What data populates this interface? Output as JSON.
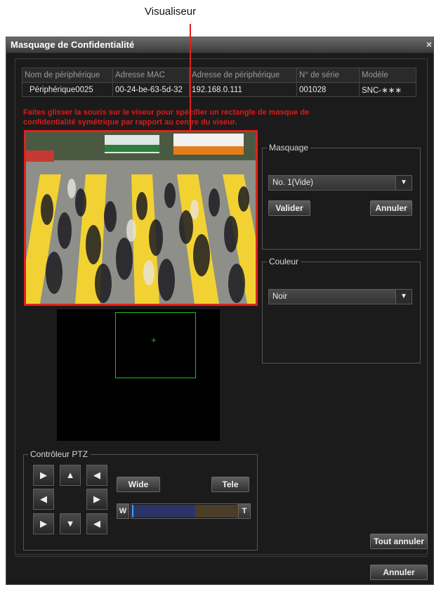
{
  "callout": {
    "label": "Visualiseur"
  },
  "window": {
    "title": "Masquage de Confidentialité",
    "close_glyph": "×"
  },
  "device_table": {
    "headers": [
      "Nom de périphérique",
      "Adresse MAC",
      "Adresse de périphérique",
      "N° de série",
      "Modèle"
    ],
    "row": [
      "Périphérique0025",
      "00-24-be-63-5d-32",
      "192.168.0.111",
      "001028",
      "SNC-∗∗∗"
    ]
  },
  "instructions": "Faites glisser la souris sur le viseur pour spécifier un rectangle de masque de confidentialité symétrique par rapport au centre du viseur.",
  "masking": {
    "legend": "Masquage",
    "selected": "No. 1(Vide)",
    "apply_label": "Valider",
    "cancel_label": "Annuler"
  },
  "color": {
    "legend": "Couleur",
    "selected": "Noir"
  },
  "ptz": {
    "legend": "Contrôleur PTZ",
    "wide_label": "Wide",
    "tele_label": "Tele",
    "w_label": "W",
    "t_label": "T",
    "zoom_position": 0.0,
    "arrows": [
      "▶",
      "▲",
      "◀",
      "◀",
      "▶",
      "▶",
      "▼",
      "◀"
    ]
  },
  "footer": {
    "cancel_all_label": "Tout annuler",
    "cancel_label": "Annuler"
  },
  "colors": {
    "accent_red": "#e0211b",
    "mask_green": "#19c419"
  },
  "icons": {
    "close": "close-icon",
    "dropdown": "chevron-down-icon"
  }
}
